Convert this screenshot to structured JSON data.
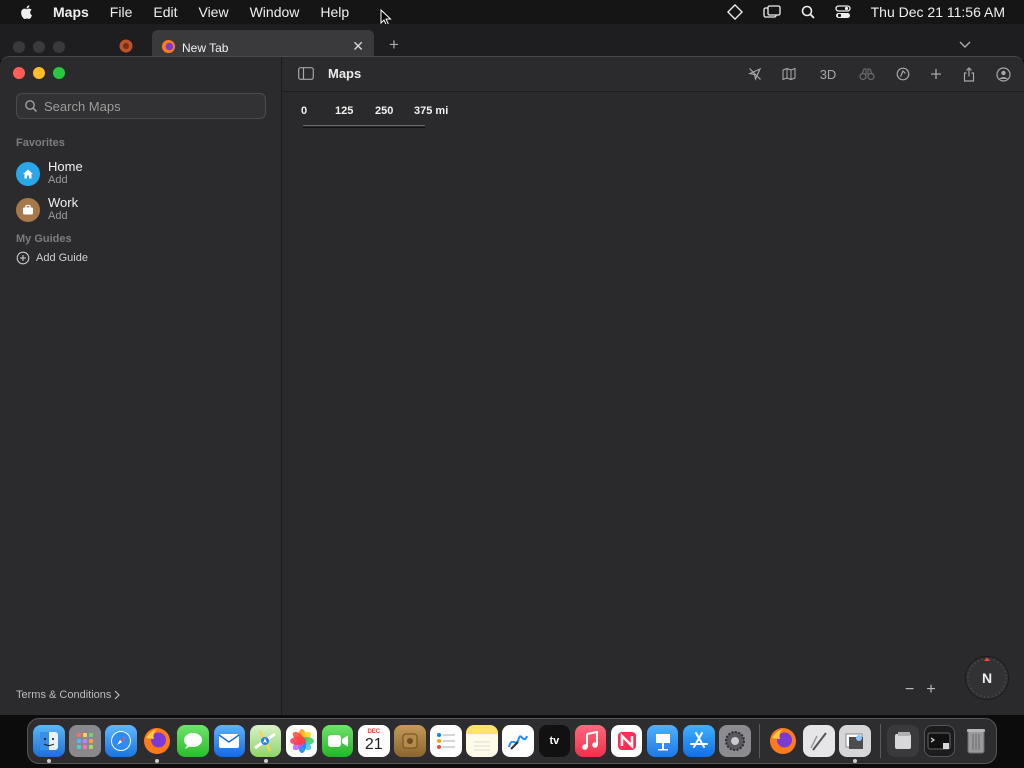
{
  "menubar": {
    "app_name": "Maps",
    "items": [
      "File",
      "Edit",
      "View",
      "Window",
      "Help"
    ],
    "clock": "Thu Dec 21  11:56 AM"
  },
  "browser": {
    "tab_title": "New Tab",
    "close_glyph": "✕",
    "new_tab_glyph": "+"
  },
  "sidebar": {
    "search_placeholder": "Search Maps",
    "favorites_heading": "Favorites",
    "favorites": [
      {
        "name": "Home",
        "sub": "Add",
        "color": "#2aa7e8"
      },
      {
        "name": "Work",
        "sub": "Add",
        "color": "#a7794a"
      }
    ],
    "guides_heading": "My Guides",
    "add_guide": "Add Guide",
    "terms": "Terms & Conditions"
  },
  "toolbar": {
    "title": "Maps",
    "three_d": "3D"
  },
  "map": {
    "scale_labels": [
      "0",
      "125",
      "250",
      "375 mi"
    ],
    "zoom_out": "−",
    "zoom_in": "+",
    "compass": "N"
  },
  "dock": {
    "calendar_month": "DEC",
    "calendar_day": "21",
    "tv_label": "tv"
  },
  "colors": {
    "close": "#ff5f57",
    "minimize": "#febc2e",
    "zoom": "#28c840"
  }
}
